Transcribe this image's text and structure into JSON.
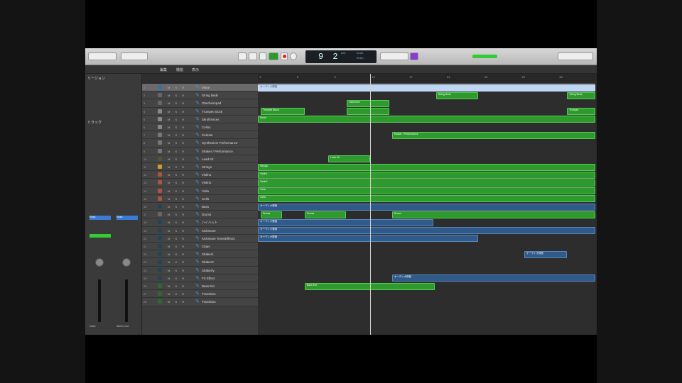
{
  "transport": {
    "position": "9 2",
    "tempo_label": "Keep",
    "bar_label": "bar",
    "beat_label": "beat"
  },
  "inspector": {
    "region_label": "リージョン",
    "track_label": "トラック",
    "strip1_name": "Voice",
    "strip2_name": "Stereo Out",
    "read1": "Read",
    "read2": "Read"
  },
  "toolbar": {
    "edit": "編集",
    "functions": "機能",
    "view": "表示"
  },
  "ruler": [
    1,
    5,
    9,
    13,
    17,
    21,
    25,
    29,
    33
  ],
  "timeline_bars": 37,
  "playhead_bar": 13,
  "tracks": [
    {
      "n": 1,
      "name": "Voice",
      "color": "#3a6ea5",
      "sel": true
    },
    {
      "n": 2,
      "name": "String Beds",
      "color": "#666"
    },
    {
      "n": 3,
      "name": "Oberheimpad",
      "color": "#666"
    },
    {
      "n": 4,
      "name": "Trumpet Stock",
      "color": "#888"
    },
    {
      "n": 5,
      "name": "SkrollVoices",
      "color": "#888"
    },
    {
      "n": 6,
      "name": "Cellos",
      "color": "#888"
    },
    {
      "n": 7,
      "name": "Celesta",
      "color": "#777"
    },
    {
      "n": 8,
      "name": "Synthesizer Performance",
      "color": "#777"
    },
    {
      "n": 9,
      "name": "Shaker / Performance",
      "color": "#777"
    },
    {
      "n": 10,
      "name": "Lead Kit",
      "color": "#553"
    },
    {
      "n": 11,
      "name": "Strings",
      "color": "#c93"
    },
    {
      "n": 12,
      "name": "Violin1",
      "color": "#a54"
    },
    {
      "n": 13,
      "name": "Violin2",
      "color": "#a54"
    },
    {
      "n": 14,
      "name": "Viola",
      "color": "#a54"
    },
    {
      "n": 15,
      "name": "Cello",
      "color": "#a54"
    },
    {
      "n": 16,
      "name": "Bass",
      "color": "#245"
    },
    {
      "n": 17,
      "name": "Drums",
      "color": "#666"
    },
    {
      "n": 18,
      "name": "ハイハット",
      "color": "#245"
    },
    {
      "n": 19,
      "name": "Kicksnare",
      "color": "#245"
    },
    {
      "n": 20,
      "name": "Kicksnare Toms/Effects",
      "color": "#245"
    },
    {
      "n": 21,
      "name": "Claps",
      "color": "#245"
    },
    {
      "n": 22,
      "name": "Shaker1",
      "color": "#245"
    },
    {
      "n": 23,
      "name": "Shaker2",
      "color": "#245"
    },
    {
      "n": 24,
      "name": "Shakerfy",
      "color": "#245"
    },
    {
      "n": 25,
      "name": "FX Effect",
      "color": "#245"
    },
    {
      "n": 26,
      "name": "Bass Ext",
      "color": "#363"
    },
    {
      "n": 27,
      "name": "Transition",
      "color": "#363"
    },
    {
      "n": 28,
      "name": "Transition",
      "color": "#363"
    }
  ],
  "regions": [
    {
      "row": 1,
      "s": 1,
      "e": 37,
      "t": "s",
      "label": "オーディオ録音"
    },
    {
      "row": 2,
      "s": 20,
      "e": 24.5,
      "t": "g",
      "label": "String Beds"
    },
    {
      "row": 2,
      "s": 34,
      "e": 37,
      "t": "g",
      "label": "String Beds"
    },
    {
      "row": 3,
      "s": 10.5,
      "e": 15,
      "t": "g",
      "label": "Oberheim"
    },
    {
      "row": 4,
      "s": 1.3,
      "e": 6,
      "t": "g",
      "label": "Trumpet Stock"
    },
    {
      "row": 4,
      "s": 10.5,
      "e": 15,
      "t": "g",
      "label": ""
    },
    {
      "row": 4,
      "s": 34,
      "e": 37,
      "t": "g",
      "label": "Trumpet"
    },
    {
      "row": 5,
      "s": 1,
      "e": 37,
      "t": "g",
      "label": "Skroll"
    },
    {
      "row": 7,
      "s": 15.3,
      "e": 37,
      "t": "g",
      "label": "Shaker / Performance"
    },
    {
      "row": 10,
      "s": 8.5,
      "e": 13,
      "t": "g",
      "label": "Lead Kit"
    },
    {
      "row": 11,
      "s": 1,
      "e": 37,
      "t": "g",
      "label": "Strings"
    },
    {
      "row": 12,
      "s": 1,
      "e": 37,
      "t": "g",
      "label": "Violin1"
    },
    {
      "row": 13,
      "s": 1,
      "e": 37,
      "t": "g",
      "label": "Violin2"
    },
    {
      "row": 14,
      "s": 1,
      "e": 37,
      "t": "g",
      "label": "Viola"
    },
    {
      "row": 15,
      "s": 1,
      "e": 37,
      "t": "g",
      "label": "Cello"
    },
    {
      "row": 16,
      "s": 1,
      "e": 37,
      "t": "b",
      "label": "オーディオ録音"
    },
    {
      "row": 17,
      "s": 1.3,
      "e": 3.6,
      "t": "g",
      "label": "Drums"
    },
    {
      "row": 17,
      "s": 6,
      "e": 10.4,
      "t": "g",
      "label": "Drums"
    },
    {
      "row": 17,
      "s": 15.3,
      "e": 37,
      "t": "g",
      "label": "Drums"
    },
    {
      "row": 18,
      "s": 1,
      "e": 19.7,
      "t": "b",
      "label": "オーディオ録音"
    },
    {
      "row": 19,
      "s": 1,
      "e": 37,
      "t": "b",
      "label": "オーディオ録音"
    },
    {
      "row": 20,
      "s": 1,
      "e": 24.5,
      "t": "b",
      "label": "オーディオ録音"
    },
    {
      "row": 22,
      "s": 29.4,
      "e": 34,
      "t": "b",
      "label": "オーディオ録音"
    },
    {
      "row": 25,
      "s": 15.3,
      "e": 37,
      "t": "b",
      "label": "オーディオ録音"
    },
    {
      "row": 26,
      "s": 6,
      "e": 19.9,
      "t": "g",
      "label": "Bass Ext"
    }
  ]
}
